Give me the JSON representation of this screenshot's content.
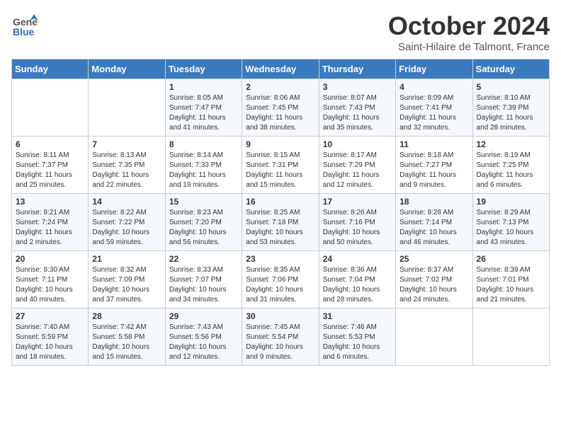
{
  "logo": {
    "line1": "General",
    "line2": "Blue"
  },
  "title": "October 2024",
  "subtitle": "Saint-Hilaire de Talmont, France",
  "days_of_week": [
    "Sunday",
    "Monday",
    "Tuesday",
    "Wednesday",
    "Thursday",
    "Friday",
    "Saturday"
  ],
  "weeks": [
    [
      {
        "day": "",
        "content": ""
      },
      {
        "day": "",
        "content": ""
      },
      {
        "day": "1",
        "content": "Sunrise: 8:05 AM\nSunset: 7:47 PM\nDaylight: 11 hours and 41 minutes."
      },
      {
        "day": "2",
        "content": "Sunrise: 8:06 AM\nSunset: 7:45 PM\nDaylight: 11 hours and 38 minutes."
      },
      {
        "day": "3",
        "content": "Sunrise: 8:07 AM\nSunset: 7:43 PM\nDaylight: 11 hours and 35 minutes."
      },
      {
        "day": "4",
        "content": "Sunrise: 8:09 AM\nSunset: 7:41 PM\nDaylight: 11 hours and 32 minutes."
      },
      {
        "day": "5",
        "content": "Sunrise: 8:10 AM\nSunset: 7:39 PM\nDaylight: 11 hours and 28 minutes."
      }
    ],
    [
      {
        "day": "6",
        "content": "Sunrise: 8:11 AM\nSunset: 7:37 PM\nDaylight: 11 hours and 25 minutes."
      },
      {
        "day": "7",
        "content": "Sunrise: 8:13 AM\nSunset: 7:35 PM\nDaylight: 11 hours and 22 minutes."
      },
      {
        "day": "8",
        "content": "Sunrise: 8:14 AM\nSunset: 7:33 PM\nDaylight: 11 hours and 19 minutes."
      },
      {
        "day": "9",
        "content": "Sunrise: 8:15 AM\nSunset: 7:31 PM\nDaylight: 11 hours and 15 minutes."
      },
      {
        "day": "10",
        "content": "Sunrise: 8:17 AM\nSunset: 7:29 PM\nDaylight: 11 hours and 12 minutes."
      },
      {
        "day": "11",
        "content": "Sunrise: 8:18 AM\nSunset: 7:27 PM\nDaylight: 11 hours and 9 minutes."
      },
      {
        "day": "12",
        "content": "Sunrise: 8:19 AM\nSunset: 7:25 PM\nDaylight: 11 hours and 6 minutes."
      }
    ],
    [
      {
        "day": "13",
        "content": "Sunrise: 8:21 AM\nSunset: 7:24 PM\nDaylight: 11 hours and 2 minutes."
      },
      {
        "day": "14",
        "content": "Sunrise: 8:22 AM\nSunset: 7:22 PM\nDaylight: 10 hours and 59 minutes."
      },
      {
        "day": "15",
        "content": "Sunrise: 8:23 AM\nSunset: 7:20 PM\nDaylight: 10 hours and 56 minutes."
      },
      {
        "day": "16",
        "content": "Sunrise: 8:25 AM\nSunset: 7:18 PM\nDaylight: 10 hours and 53 minutes."
      },
      {
        "day": "17",
        "content": "Sunrise: 8:26 AM\nSunset: 7:16 PM\nDaylight: 10 hours and 50 minutes."
      },
      {
        "day": "18",
        "content": "Sunrise: 8:28 AM\nSunset: 7:14 PM\nDaylight: 10 hours and 46 minutes."
      },
      {
        "day": "19",
        "content": "Sunrise: 8:29 AM\nSunset: 7:13 PM\nDaylight: 10 hours and 43 minutes."
      }
    ],
    [
      {
        "day": "20",
        "content": "Sunrise: 8:30 AM\nSunset: 7:11 PM\nDaylight: 10 hours and 40 minutes."
      },
      {
        "day": "21",
        "content": "Sunrise: 8:32 AM\nSunset: 7:09 PM\nDaylight: 10 hours and 37 minutes."
      },
      {
        "day": "22",
        "content": "Sunrise: 8:33 AM\nSunset: 7:07 PM\nDaylight: 10 hours and 34 minutes."
      },
      {
        "day": "23",
        "content": "Sunrise: 8:35 AM\nSunset: 7:06 PM\nDaylight: 10 hours and 31 minutes."
      },
      {
        "day": "24",
        "content": "Sunrise: 8:36 AM\nSunset: 7:04 PM\nDaylight: 10 hours and 28 minutes."
      },
      {
        "day": "25",
        "content": "Sunrise: 8:37 AM\nSunset: 7:02 PM\nDaylight: 10 hours and 24 minutes."
      },
      {
        "day": "26",
        "content": "Sunrise: 8:39 AM\nSunset: 7:01 PM\nDaylight: 10 hours and 21 minutes."
      }
    ],
    [
      {
        "day": "27",
        "content": "Sunrise: 7:40 AM\nSunset: 5:59 PM\nDaylight: 10 hours and 18 minutes."
      },
      {
        "day": "28",
        "content": "Sunrise: 7:42 AM\nSunset: 5:58 PM\nDaylight: 10 hours and 15 minutes."
      },
      {
        "day": "29",
        "content": "Sunrise: 7:43 AM\nSunset: 5:56 PM\nDaylight: 10 hours and 12 minutes."
      },
      {
        "day": "30",
        "content": "Sunrise: 7:45 AM\nSunset: 5:54 PM\nDaylight: 10 hours and 9 minutes."
      },
      {
        "day": "31",
        "content": "Sunrise: 7:46 AM\nSunset: 5:53 PM\nDaylight: 10 hours and 6 minutes."
      },
      {
        "day": "",
        "content": ""
      },
      {
        "day": "",
        "content": ""
      }
    ]
  ]
}
